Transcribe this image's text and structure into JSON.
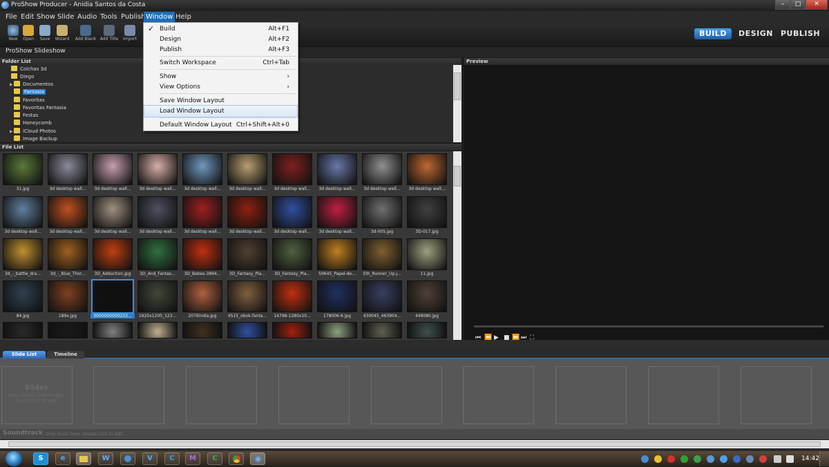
{
  "window": {
    "title": "ProShow Producer - Anidia Santos da Costa",
    "min_glyph": "–",
    "max_glyph": "□",
    "close_glyph": "✕"
  },
  "menubar": [
    "File",
    "Edit",
    "Show",
    "Slide",
    "Audio",
    "Tools",
    "Publish",
    "Window",
    "Help"
  ],
  "toolbar": {
    "new": "New",
    "open": "Open",
    "save": "Save",
    "wizard": "Wizard",
    "add_blank": "Add Blank",
    "add_title": "Add Title",
    "import": "Import"
  },
  "modes": {
    "build": "BUILD",
    "design": "DESIGN",
    "publish": "PUBLISH"
  },
  "project_title": "ProShow Slideshow",
  "folder_list": {
    "header": "Folder List",
    "items": [
      "Colchas 3d",
      "Diego",
      "Documentos",
      "Fantasia",
      "Favoritas",
      "Favoritas Fantasia",
      "Festas",
      "Honeycomb",
      "iCloud Photos",
      "Image Backup"
    ],
    "selected": "Fantasia"
  },
  "file_list": {
    "header": "File List",
    "row1": [
      "31.jpg",
      "3d desktop wall...",
      "3d desktop wall...",
      "3d desktop wall...",
      "3d desktop wall...",
      "3d desktop wall...",
      "3d desktop wall...",
      "3d desktop wall...",
      "3d desktop wall...",
      "3d desktop wall..."
    ],
    "row2": [
      "3d desktop wall...",
      "3d desktop wall...",
      "3d desktop wall...",
      "3d desktop wall...",
      "3d desktop wall...",
      "3d desktop wall...",
      "3d desktop wall...",
      "3d desktop wall...",
      "3d-005.jpg",
      "3D-017.jpg"
    ],
    "row3": [
      "3d_-_battle_dra...",
      "3d_-_Blue_Thor...",
      "3D_Adduction.jpg",
      "3D_And_Fantas...",
      "3D_Bebes-3894...",
      "3D_Fantasy_Pla...",
      "3D_Fantasy_Pla...",
      "50645_Papel-de...",
      "5th_Runner_Up.j...",
      "11.jpg"
    ],
    "row4": [
      "84.jpg",
      "189x.jpg",
      "0000000000233...",
      "1920x1200_123...",
      "2076india.jpg",
      "4515_obok-fanta...",
      "14798-1280x10...",
      "178006-6.jpg",
      "430045_463904...",
      "449080.jpg"
    ],
    "selected_label": "0000000000233...",
    "thumb_colors": [
      [
        "#5a7a3a",
        "#8a8a9a",
        "#c8a0b0",
        "#d8b0a8",
        "#7098c0",
        "#b8a070",
        "#802020",
        "#6878a8",
        "#909090",
        "#c06830"
      ],
      [
        "#6080a0",
        "#c05020",
        "#a09080",
        "#505060",
        "#a02020",
        "#902010",
        "#3050a0",
        "#c02040",
        "#707070",
        "#404040"
      ],
      [
        "#c09030",
        "#a06020",
        "#c04010",
        "#307040",
        "#c03010",
        "#504030",
        "#506040",
        "#c08020",
        "#806030",
        "#a0a080"
      ],
      [
        "#304050",
        "#804020",
        "#101010",
        "#404838",
        "#b06040",
        "#806040",
        "#c03010",
        "#203060",
        "#384060",
        "#504038"
      ],
      [
        "#2a2a2a",
        "#1a1a1a",
        "#808080",
        "#c0b090",
        "#403020",
        "#3050a0",
        "#a02010",
        "#90a080",
        "#606050",
        "#405050"
      ]
    ]
  },
  "preview": {
    "header": "Preview"
  },
  "player_controls": [
    "⏮",
    "⏪",
    "▶",
    "■",
    "⏩",
    "⏭",
    "⛶"
  ],
  "tabs": {
    "slide_list": "Slide List",
    "timeline": "Timeline"
  },
  "slides": {
    "title": "Slides",
    "hint1": "Drop photos / videos here.",
    "hint2": "Double click to edit."
  },
  "soundtrack": {
    "title": "Soundtrack",
    "hint": "Drop music here.  Double click to edit."
  },
  "window_menu": {
    "items": [
      {
        "label": "Build",
        "shortcut": "Alt+F1",
        "checked": true
      },
      {
        "label": "Design",
        "shortcut": "Alt+F2"
      },
      {
        "label": "Publish",
        "shortcut": "Alt+F3"
      },
      {
        "label": "Switch Workspace",
        "shortcut": "Ctrl+Tab"
      },
      {
        "label": "Show",
        "shortcut": "›"
      },
      {
        "label": "View Options",
        "shortcut": "›"
      },
      {
        "label": "Save Window Layout",
        "shortcut": ""
      },
      {
        "label": "Load Window Layout",
        "shortcut": ""
      },
      {
        "label": "Default Window Layout",
        "shortcut": "Ctrl+Shift+Alt+0"
      }
    ],
    "checkmark": "✓",
    "highlighted": "Load Window Layout"
  },
  "taskbar": {
    "clock": "14:42",
    "pinned": [
      "S",
      "e",
      "",
      "W",
      "",
      "V",
      "C",
      "M",
      "C",
      "",
      ""
    ]
  }
}
